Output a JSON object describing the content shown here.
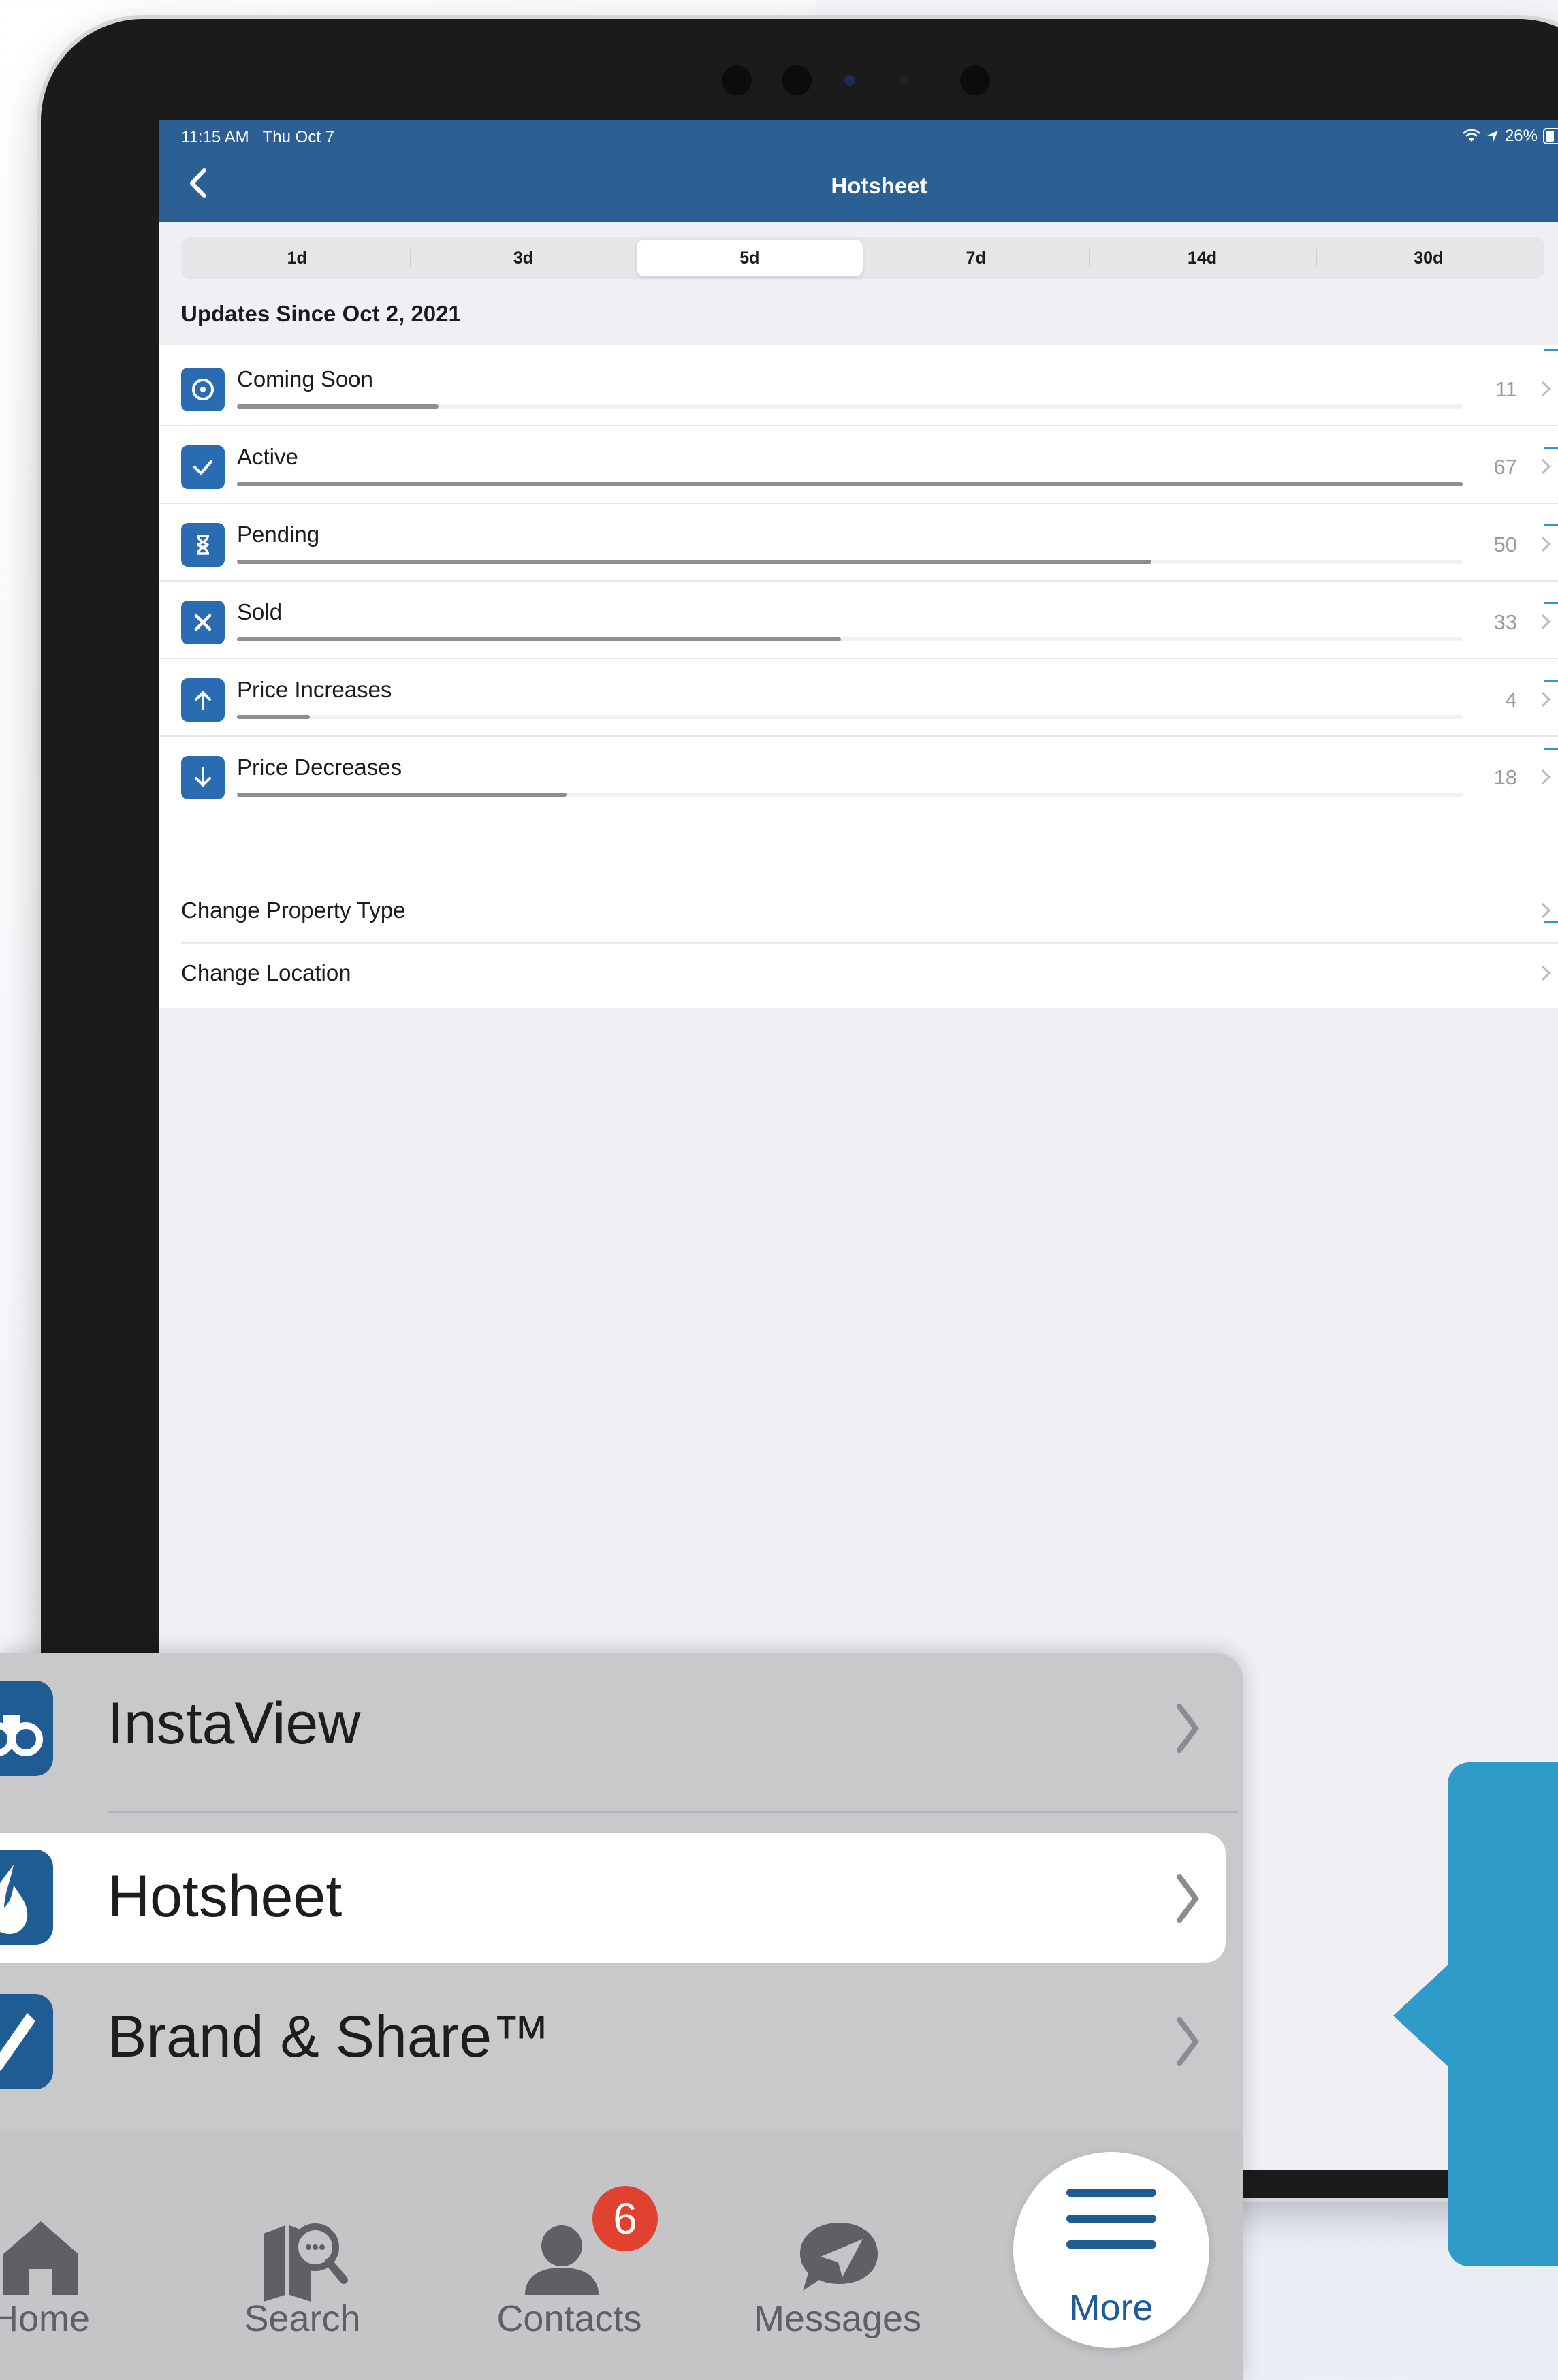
{
  "status_bar": {
    "time": "11:15 AM",
    "date": "Thu Oct 7",
    "battery": "26%"
  },
  "header": {
    "title": "Hotsheet"
  },
  "range_tabs": [
    {
      "label": "1d"
    },
    {
      "label": "3d"
    },
    {
      "label": "5d",
      "active": true
    },
    {
      "label": "7d"
    },
    {
      "label": "14d"
    },
    {
      "label": "30d"
    }
  ],
  "updates_title": "Updates Since Oct 2, 2021",
  "stats": [
    {
      "label": "Coming Soon",
      "count": "11",
      "value": 11,
      "icon": "clock-icon"
    },
    {
      "label": "Active",
      "count": "67",
      "value": 67,
      "icon": "check-icon"
    },
    {
      "label": "Pending",
      "count": "50",
      "value": 50,
      "icon": "hourglass-icon"
    },
    {
      "label": "Sold",
      "count": "33",
      "value": 33,
      "icon": "x-icon"
    },
    {
      "label": "Price Increases",
      "count": "4",
      "value": 4,
      "icon": "arrow-up-icon"
    },
    {
      "label": "Price Decreases",
      "count": "18",
      "value": 18,
      "icon": "arrow-down-icon"
    }
  ],
  "options": [
    {
      "label": "Change Property Type"
    },
    {
      "label": "Change Location"
    }
  ],
  "menu": [
    {
      "label": "InstaView",
      "icon": "binoculars-icon"
    },
    {
      "label": "Hotsheet",
      "icon": "flame-icon",
      "selected": true
    },
    {
      "label": "Brand & Share™",
      "icon": "pen-icon"
    }
  ],
  "tabbar": {
    "home": "Home",
    "search": "Search",
    "contacts": "Contacts",
    "contacts_badge": "6",
    "messages": "Messages",
    "more": "More"
  },
  "colors": {
    "header": "#2c5f93",
    "icon": "#2a6cb2",
    "callout": "#2f9bc8",
    "badge": "#e1412f"
  }
}
